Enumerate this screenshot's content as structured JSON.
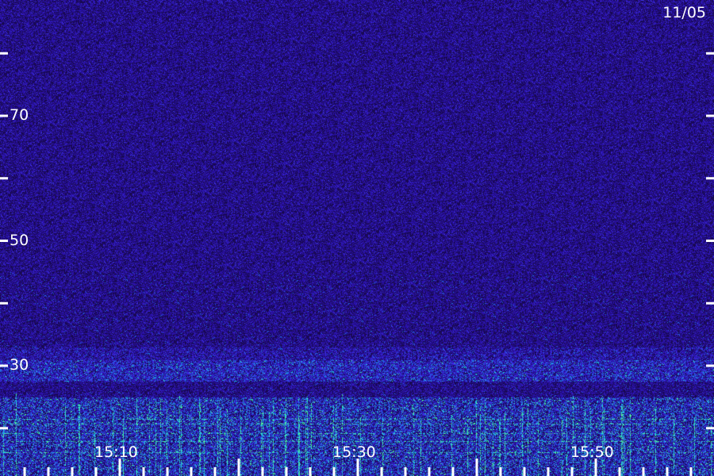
{
  "date_label": "11/05",
  "chart_data": {
    "type": "heatmap",
    "title": "",
    "xlabel": "",
    "ylabel": "",
    "x_tick_labels": [
      {
        "value": 10,
        "label": "15:10"
      },
      {
        "value": 30,
        "label": "15:30"
      },
      {
        "value": 50,
        "label": "15:50"
      }
    ],
    "y_tick_labels": [
      {
        "value": 70,
        "label": "70"
      },
      {
        "value": 50,
        "label": "50"
      },
      {
        "value": 30,
        "label": "30"
      }
    ],
    "x_range_minutes": [
      0,
      60
    ],
    "y_range": [
      10,
      85
    ],
    "y_minor_tick_step": 10,
    "x_minor_tick_step": 2,
    "x_major_tick_step": 10,
    "colormap": [
      "#1a0a55",
      "#2a12a8",
      "#3b2fe0",
      "#1e6fe8",
      "#22c4e0",
      "#4ff5a0"
    ],
    "bands": [
      {
        "y_from": 10,
        "y_to": 25,
        "intensity": "high"
      },
      {
        "y_from": 27.5,
        "y_to": 31,
        "intensity": "medium"
      },
      {
        "y_from": 31,
        "y_to": 33,
        "intensity": "low-medium"
      },
      {
        "y_from": 33,
        "y_to": 85,
        "intensity": "background"
      }
    ],
    "grid": false,
    "legend": "none"
  }
}
